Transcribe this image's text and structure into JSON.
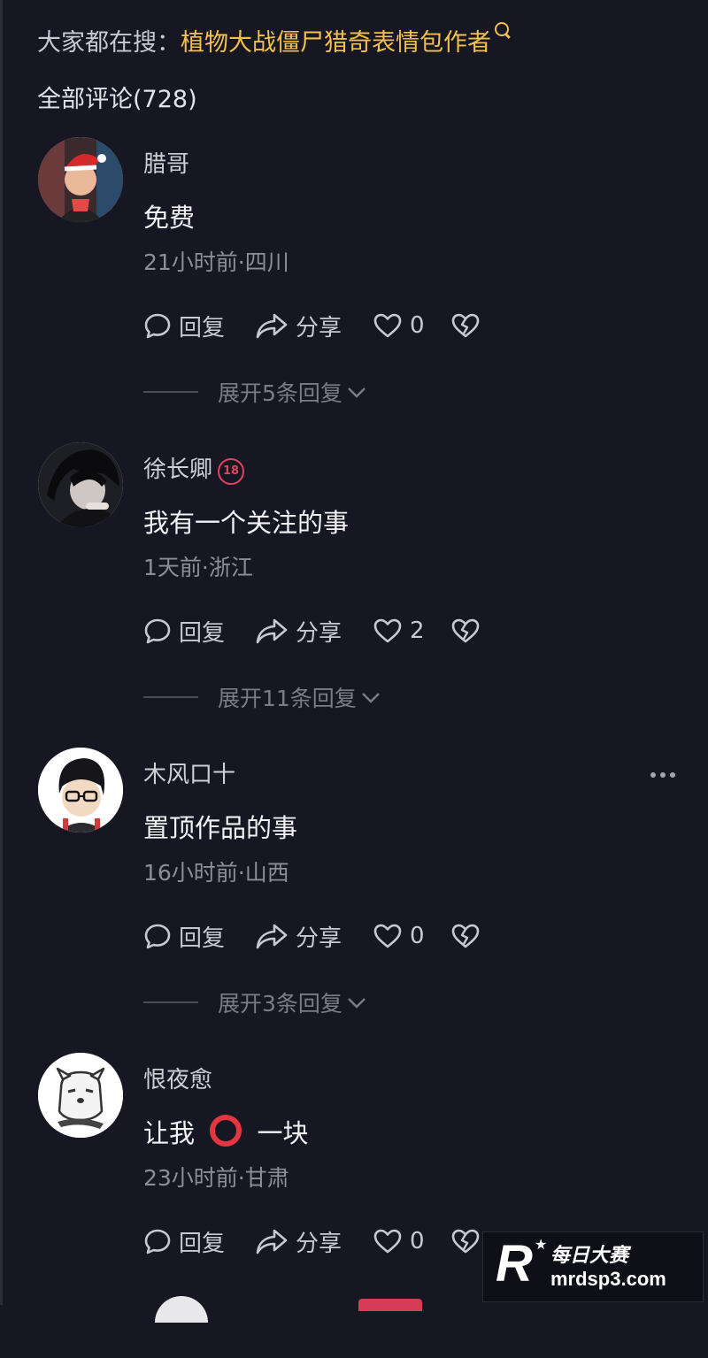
{
  "search_hint": {
    "prefix": "大家都在搜：",
    "keyword": "植物大战僵尸猎奇表情包作者"
  },
  "comments_header": {
    "label": "全部评论(728)"
  },
  "comments": [
    {
      "user": "腊哥",
      "text": "免费",
      "meta": "21小时前·四川",
      "likes": "0",
      "expand": "展开5条回复"
    },
    {
      "user": "徐长卿",
      "badge": "18",
      "text": "我有一个关注的事",
      "meta": "1天前·浙江",
      "likes": "2",
      "expand": "展开11条回复"
    },
    {
      "user": "木风口十",
      "text": "置顶作品的事",
      "meta": "16小时前·山西",
      "likes": "0",
      "expand": "展开3条回复"
    },
    {
      "user": "恨夜愈",
      "text_before": "让我",
      "text_after": "一块",
      "meta": "23小时前·甘肃",
      "likes": "0"
    }
  ],
  "actions": {
    "reply": "回复",
    "share": "分享"
  },
  "watermark": {
    "brand_cn": "每日大赛",
    "letter": "R",
    "url": "mrdsp3.com"
  },
  "colors": {
    "background": "#161722",
    "keyword": "#f2c14b",
    "meta": "#8d8e97",
    "badge": "#e0445a"
  }
}
